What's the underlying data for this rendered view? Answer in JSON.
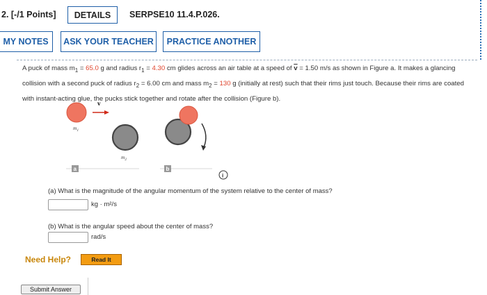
{
  "header": {
    "points": "2. [-/1 Points]",
    "details_label": "DETAILS",
    "problem_code": "SERPSE10 11.4.P.026."
  },
  "toolbar": {
    "my_notes": "MY NOTES",
    "ask_teacher": "ASK YOUR TEACHER",
    "practice_another": "PRACTICE ANOTHER"
  },
  "problem": {
    "t1": "A puck of mass m",
    "t1_sub": "1",
    "t1b": " = ",
    "m1": "65.0",
    "t2": " g and radius r",
    "t2_sub": "1",
    "t2b": " = ",
    "r1": "4.30",
    "t3": " cm glides across an air table at a speed of ",
    "v_symbol": "v",
    "t4": " = 1.50 m/s as shown in Figure a. It makes a glancing collision with a second puck of radius r",
    "t4_sub": "2",
    "t4b": " = 6.00 cm and mass m",
    "t4_sub2": "2",
    "t4c": " = ",
    "m2": "130",
    "t5": " g (initially at rest) such that their rims just touch. Because their rims are coated with instant-acting glue, the pucks stick together and rotate after the collision (Figure b)."
  },
  "figure": {
    "label_m1": "m",
    "label_m1_sub": "1",
    "label_m2": "m",
    "label_m2_sub": "2",
    "label_v": "v",
    "tag_a": "a",
    "tag_b": "b",
    "info_icon": "i"
  },
  "questions": {
    "a_text": "(a) What is the magnitude of the angular momentum of the system relative to the center of mass?",
    "a_unit": "kg · m²/s",
    "a_value": "",
    "b_text": "(b) What is the angular speed about the center of mass?",
    "b_unit": "rad/s",
    "b_value": ""
  },
  "help": {
    "need_help": "Need Help?",
    "read_it": "Read It"
  },
  "submit_label": "Submit Answer",
  "colors": {
    "accent_blue": "#1f5fa8",
    "red_value": "#e0432b",
    "puck_red": "#ef7560",
    "puck_gray": "#8a8a8a",
    "read_it_orange": "#f39c12"
  }
}
